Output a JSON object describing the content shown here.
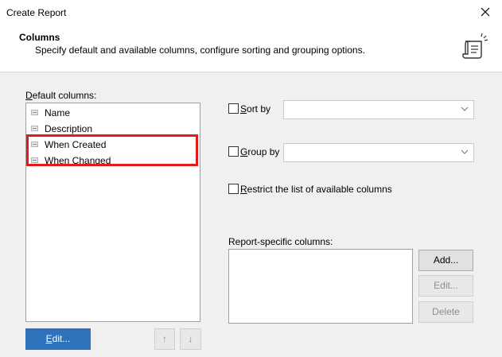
{
  "window": {
    "title": "Create Report"
  },
  "header": {
    "title": "Columns",
    "description": "Specify default and available columns, configure sorting and grouping options."
  },
  "default_columns": {
    "label_access_key": "D",
    "label_rest": "efault columns:",
    "items": [
      "Name",
      "Description",
      "When Created",
      "When Changed"
    ]
  },
  "buttons": {
    "edit_access_key": "E",
    "edit_rest": "dit...",
    "up_arrow": "↑",
    "down_arrow": "↓",
    "add": "Add...",
    "edit_specific": "Edit...",
    "delete": "Delete"
  },
  "options": {
    "sort_by_access_key": "S",
    "sort_by_rest": "ort by",
    "group_by_access_key": "G",
    "group_by_rest": "roup by",
    "restrict_access_key": "R",
    "restrict_rest": "estrict the list of available columns",
    "sort_value": "",
    "group_value": ""
  },
  "report_specific": {
    "label": "Report-specific columns:"
  },
  "colors": {
    "primary": "#2e72bb",
    "highlight": "#e31b1b"
  }
}
